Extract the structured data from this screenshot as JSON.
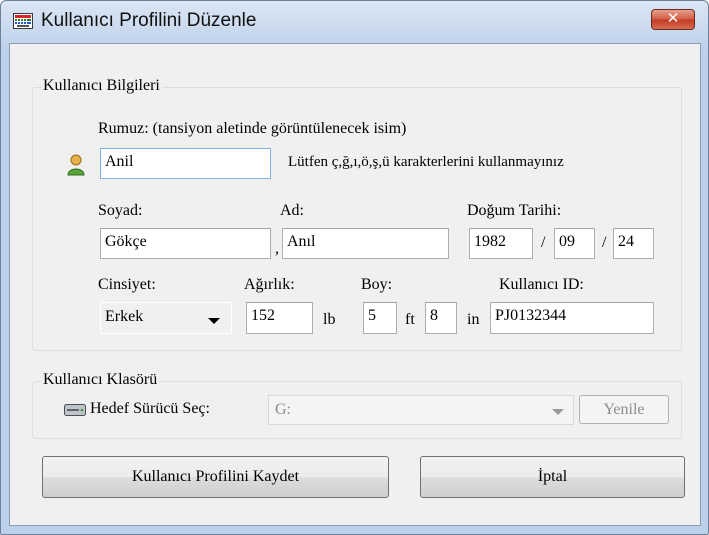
{
  "window": {
    "title": "Kullanıcı Profilini Düzenle",
    "icons": {
      "app": "keyboard-icon",
      "close": "close-icon"
    },
    "close_glyph": "✕"
  },
  "user_info": {
    "group_title": "Kullanıcı Bilgileri",
    "nickname_label": "Rumuz: (tansiyon aletinde görüntülenecek isim)",
    "nickname_value": "Anil",
    "nickname_hint": "Lütfen ç,ğ,ı,ö,ş,ü karakterlerini kullanmayınız",
    "icon": "user-icon",
    "surname_label": "Soyad:",
    "surname_value": "Gökçe",
    "comma": ",",
    "name_label": "Ad:",
    "name_value": "Anıl",
    "birth_label": "Doğum Tarihi:",
    "birth_year": "1982",
    "birth_month": "09",
    "birth_day": "24",
    "date_separator": "/",
    "gender_label": "Cinsiyet:",
    "gender_value": "Erkek",
    "weight_label": "Ağırlık:",
    "weight_value": "152",
    "weight_unit": "lb",
    "height_label": "Boy:",
    "height_ft_value": "5",
    "height_ft_unit": "ft",
    "height_in_value": "8",
    "height_in_unit": "in",
    "user_id_label": "Kullanıcı ID:",
    "user_id_value": "PJ0132344"
  },
  "user_folder": {
    "group_title": "Kullanıcı Klasörü",
    "icon": "drive-icon",
    "drive_label": "Hedef Sürücü Seç:",
    "drive_value": "G:",
    "refresh_label": "Yenile"
  },
  "actions": {
    "save_label": "Kullanıcı Profilini Kaydet",
    "cancel_label": "İptal"
  }
}
